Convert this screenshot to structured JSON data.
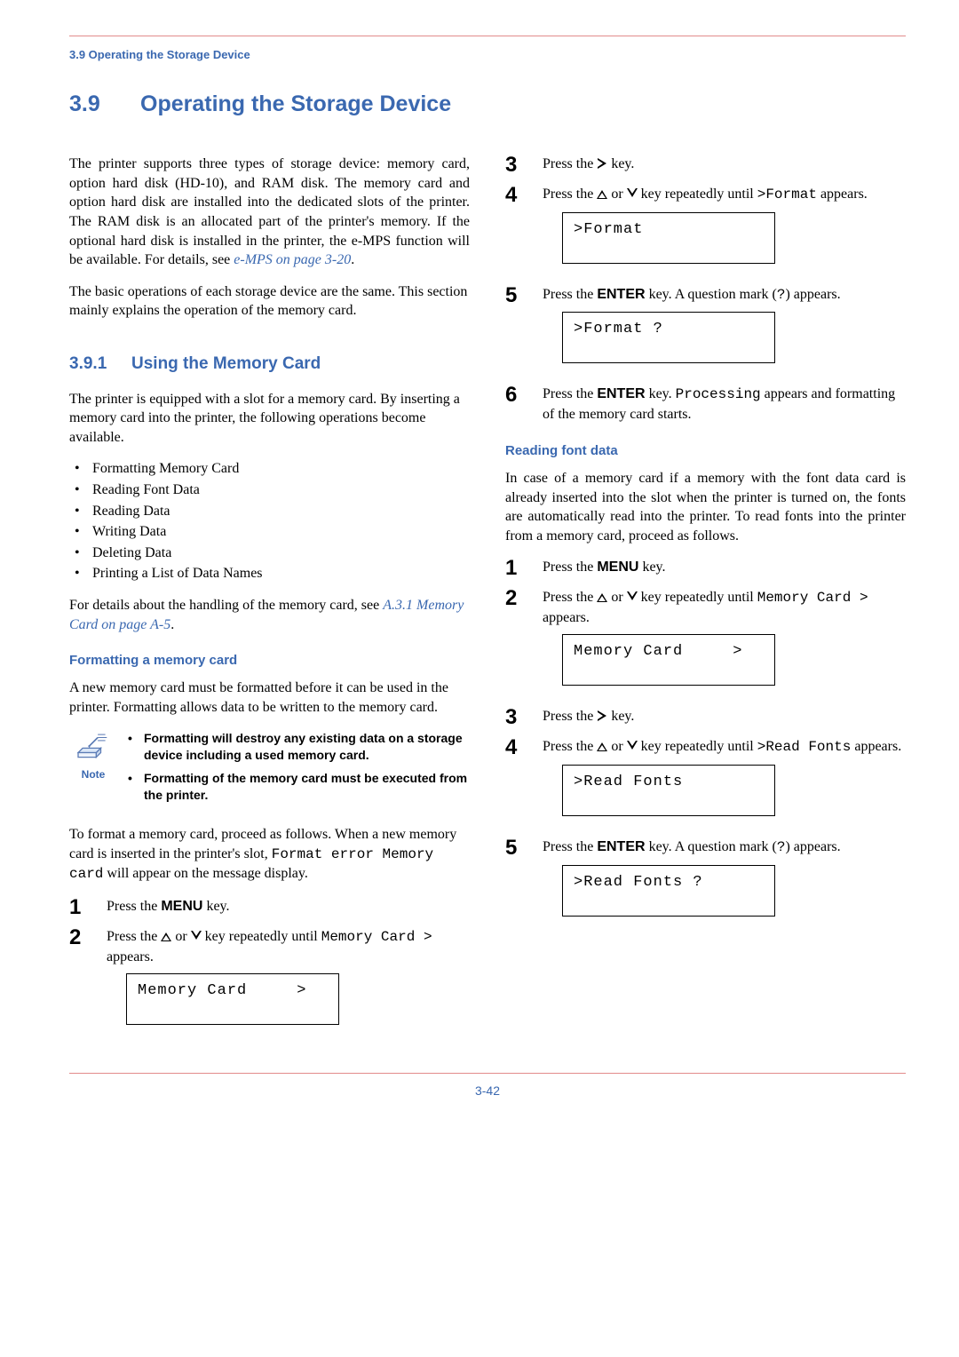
{
  "runningHead": "3.9 Operating the Storage Device",
  "section": {
    "num": "3.9",
    "title": "Operating the Storage Device"
  },
  "intro1a": "The printer supports three types of storage device: memory card, option hard disk (HD-10), and RAM disk. The memory card and option hard disk are installed into the dedicated slots of the printer. The RAM disk is an allocated part of the printer's memory. If the optional hard disk is installed in the printer, the e-MPS function will be available. For details, see ",
  "intro1_link": "e-MPS on page 3-20",
  "intro1b": ".",
  "intro2": "The basic operations of each storage device are the same. This section mainly explains the operation of the memory card.",
  "sub": {
    "num": "3.9.1",
    "title": "Using the Memory Card"
  },
  "sub_intro": "The printer is equipped with a slot for a memory card. By inserting a memory card into the printer, the following operations become available.",
  "ops": [
    "Formatting Memory Card",
    "Reading Font Data",
    "Reading Data",
    "Writing Data",
    "Deleting Data",
    "Printing a List of Data Names"
  ],
  "handle_a": " For details about the handling of the memory card, see ",
  "handle_link": "A.3.1 Memory Card on page A-5",
  "handle_b": ".",
  "fmt_head": "Formatting a memory card",
  "fmt_intro": "A new memory card must be formatted before it can be used in the printer. Formatting allows data to be written to the memory card.",
  "note_label": "Note",
  "note_items": [
    "Formatting will destroy any existing data on a storage device including a used memory card.",
    "Formatting of the memory card must be executed from the printer."
  ],
  "fmt_pre_a": "To format a memory card, proceed as follows. When a new memory card is inserted in the printer's slot, ",
  "fmt_pre_code1": "Format error Memory card",
  "fmt_pre_b": " will appear on the message display.",
  "menu_key": "MENU",
  "enter_key": "ENTER",
  "press_the_a": "Press the ",
  "press_the_b": " key.",
  "step_updown_a": "Press the ",
  "step_updown_mid": " or ",
  "step_updown_b": " key repeatedly until ",
  "mem_card_code": " Memory Card >",
  "appears_txt": " appears.",
  "lcd_memcard": "Memory Card     >",
  "step_right_a": "Press the ",
  "step_right_b": " key.",
  "fmt_code": ">Format",
  "fmt_appears": " appears.",
  "lcd_format": ">Format",
  "enter_q_a": "Press the ",
  "enter_q_b": " key. A question mark (",
  "enter_q_code": "?",
  "enter_q_c": ") appears.",
  "lcd_format_q": ">Format ?",
  "step6_a": "Press the ",
  "step6_b": " key. ",
  "step6_code": "Processing",
  "step6_c": " appears and formatting of the memory card starts.",
  "read_head": "Reading font data",
  "read_intro": "In case of a memory card if a memory with the font data card is already inserted into the slot when the printer is turned on, the fonts are automatically read into the printer. To read fonts into the printer from a memory card, proceed as follows.",
  "mem_card_code2": "Memory Card >",
  "readfonts_code": ">Read Fonts",
  "readfonts_appears": " appears.",
  "lcd_readfonts": ">Read Fonts",
  "lcd_readfonts_q": ">Read Fonts ?",
  "page_no": "3-42"
}
